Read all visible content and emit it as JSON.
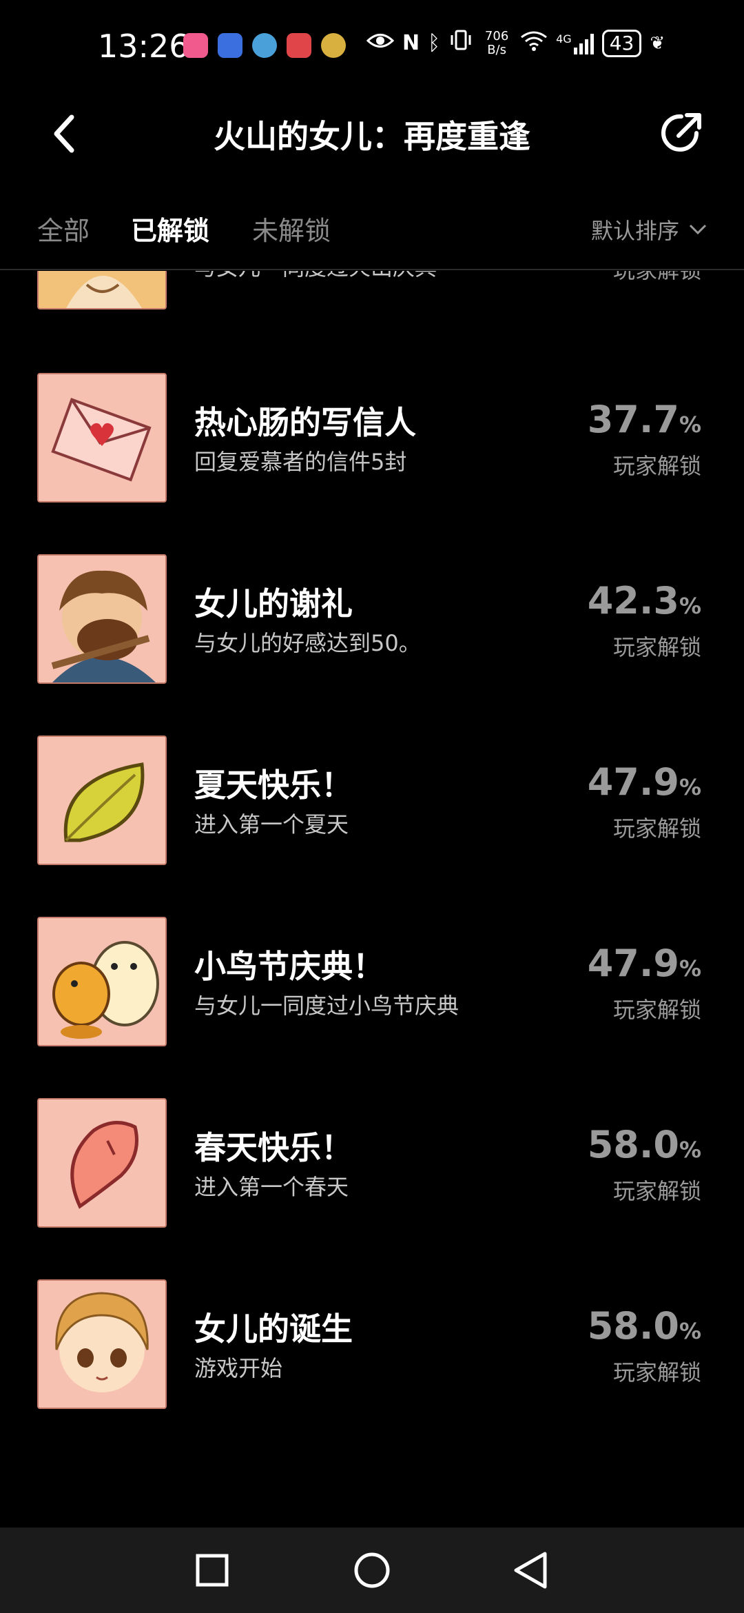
{
  "status": {
    "time": "13:26",
    "network_speed": "706\nB/s",
    "signal": "4G",
    "battery": "43"
  },
  "header": {
    "title": "火山的女儿：再度重逢",
    "back_icon": "chevron-left-icon",
    "share_icon": "share-icon"
  },
  "tabs": [
    {
      "label": "全部",
      "active": false
    },
    {
      "label": "已解锁",
      "active": true
    },
    {
      "label": "未解锁",
      "active": false
    }
  ],
  "sort": {
    "label": "默认排序"
  },
  "achievements": [
    {
      "name": "",
      "desc": "与女儿一同度过火山庆典",
      "pct": "",
      "unlock_label": "玩家解锁",
      "icon": "girl-portrait-icon"
    },
    {
      "name": "热心肠的写信人",
      "desc": "回复爱慕者的信件5封",
      "pct": "37.7",
      "unlock_label": "玩家解锁",
      "icon": "love-letter-icon"
    },
    {
      "name": "女儿的谢礼",
      "desc": "与女儿的好感达到50。",
      "pct": "42.3",
      "unlock_label": "玩家解锁",
      "icon": "bearded-man-icon"
    },
    {
      "name": "夏天快乐！",
      "desc": "进入第一个夏天",
      "pct": "47.9",
      "unlock_label": "玩家解锁",
      "icon": "leaf-icon"
    },
    {
      "name": "小鸟节庆典！",
      "desc": "与女儿一同度过小鸟节庆典",
      "pct": "47.9",
      "unlock_label": "玩家解锁",
      "icon": "birds-icon"
    },
    {
      "name": "春天快乐！",
      "desc": "进入第一个春天",
      "pct": "58.0",
      "unlock_label": "玩家解锁",
      "icon": "petal-icon"
    },
    {
      "name": "女儿的诞生",
      "desc": "游戏开始",
      "pct": "58.0",
      "unlock_label": "玩家解锁",
      "icon": "baby-portrait-icon"
    }
  ],
  "percent_sign": "%",
  "colors": {
    "background": "#000000",
    "pct_text": "#9a9a9a",
    "thumb_bg": "#f7c1b2"
  }
}
